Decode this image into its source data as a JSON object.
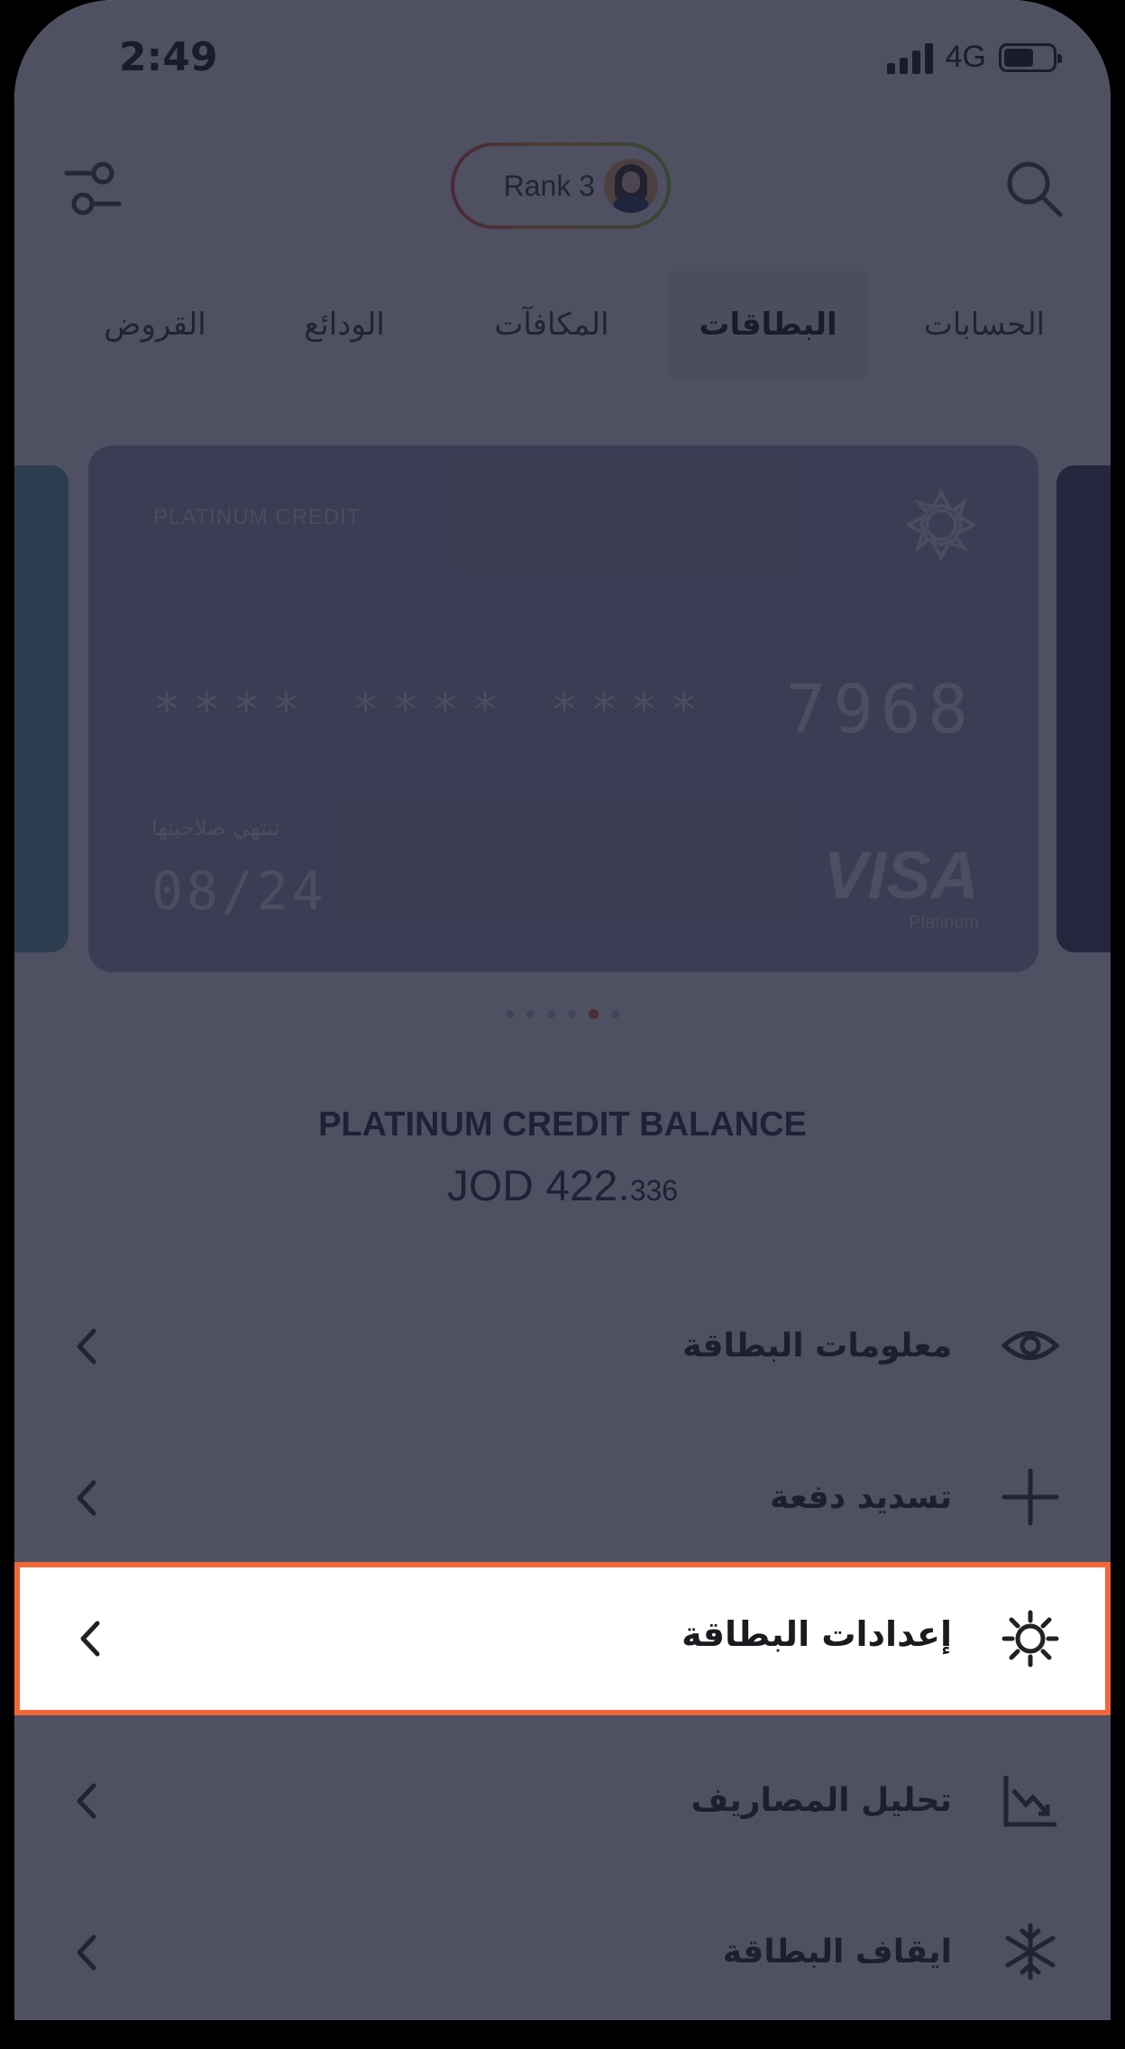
{
  "status_bar": {
    "time": "2:49",
    "network": "4G",
    "battery_level": 0.62
  },
  "header": {
    "rank_label": "Rank 3",
    "filter_icon": "sliders-icon",
    "search_icon": "search-icon"
  },
  "tabs": [
    {
      "label": "الحسابات",
      "active": false
    },
    {
      "label": "البطاقات",
      "active": true
    },
    {
      "label": "المكافآت",
      "active": false
    },
    {
      "label": "الودائع",
      "active": false
    },
    {
      "label": "القروض",
      "active": false
    }
  ],
  "card": {
    "type": "PLATINUM CREDIT",
    "masked_groups": "****  ****  ****",
    "last4": "7968",
    "expiry_label": "تنتهي صلاحيتها",
    "expiry": "08/24",
    "brand": "VISA",
    "tier": "Platinum"
  },
  "pager": {
    "count": 6,
    "active_index": 4
  },
  "balance": {
    "title": "PLATINUM CREDIT BALANCE",
    "amount_main": "JOD 422.",
    "amount_fraction": "336"
  },
  "menu": [
    {
      "label": "معلومات البطاقة",
      "icon": "eye-icon"
    },
    {
      "label": "تسديد دفعة",
      "icon": "plus-icon"
    },
    {
      "label": "إعدادات البطاقة",
      "icon": "gear-icon",
      "highlighted": true
    },
    {
      "label": "تحليل المصاريف",
      "icon": "chart-down-icon"
    },
    {
      "label": "ايقاف البطاقة",
      "icon": "snowflake-icon"
    }
  ],
  "colors": {
    "highlight_border": "#f0683a",
    "overlay": "#1e1f34",
    "card": "#a6a8c3"
  }
}
